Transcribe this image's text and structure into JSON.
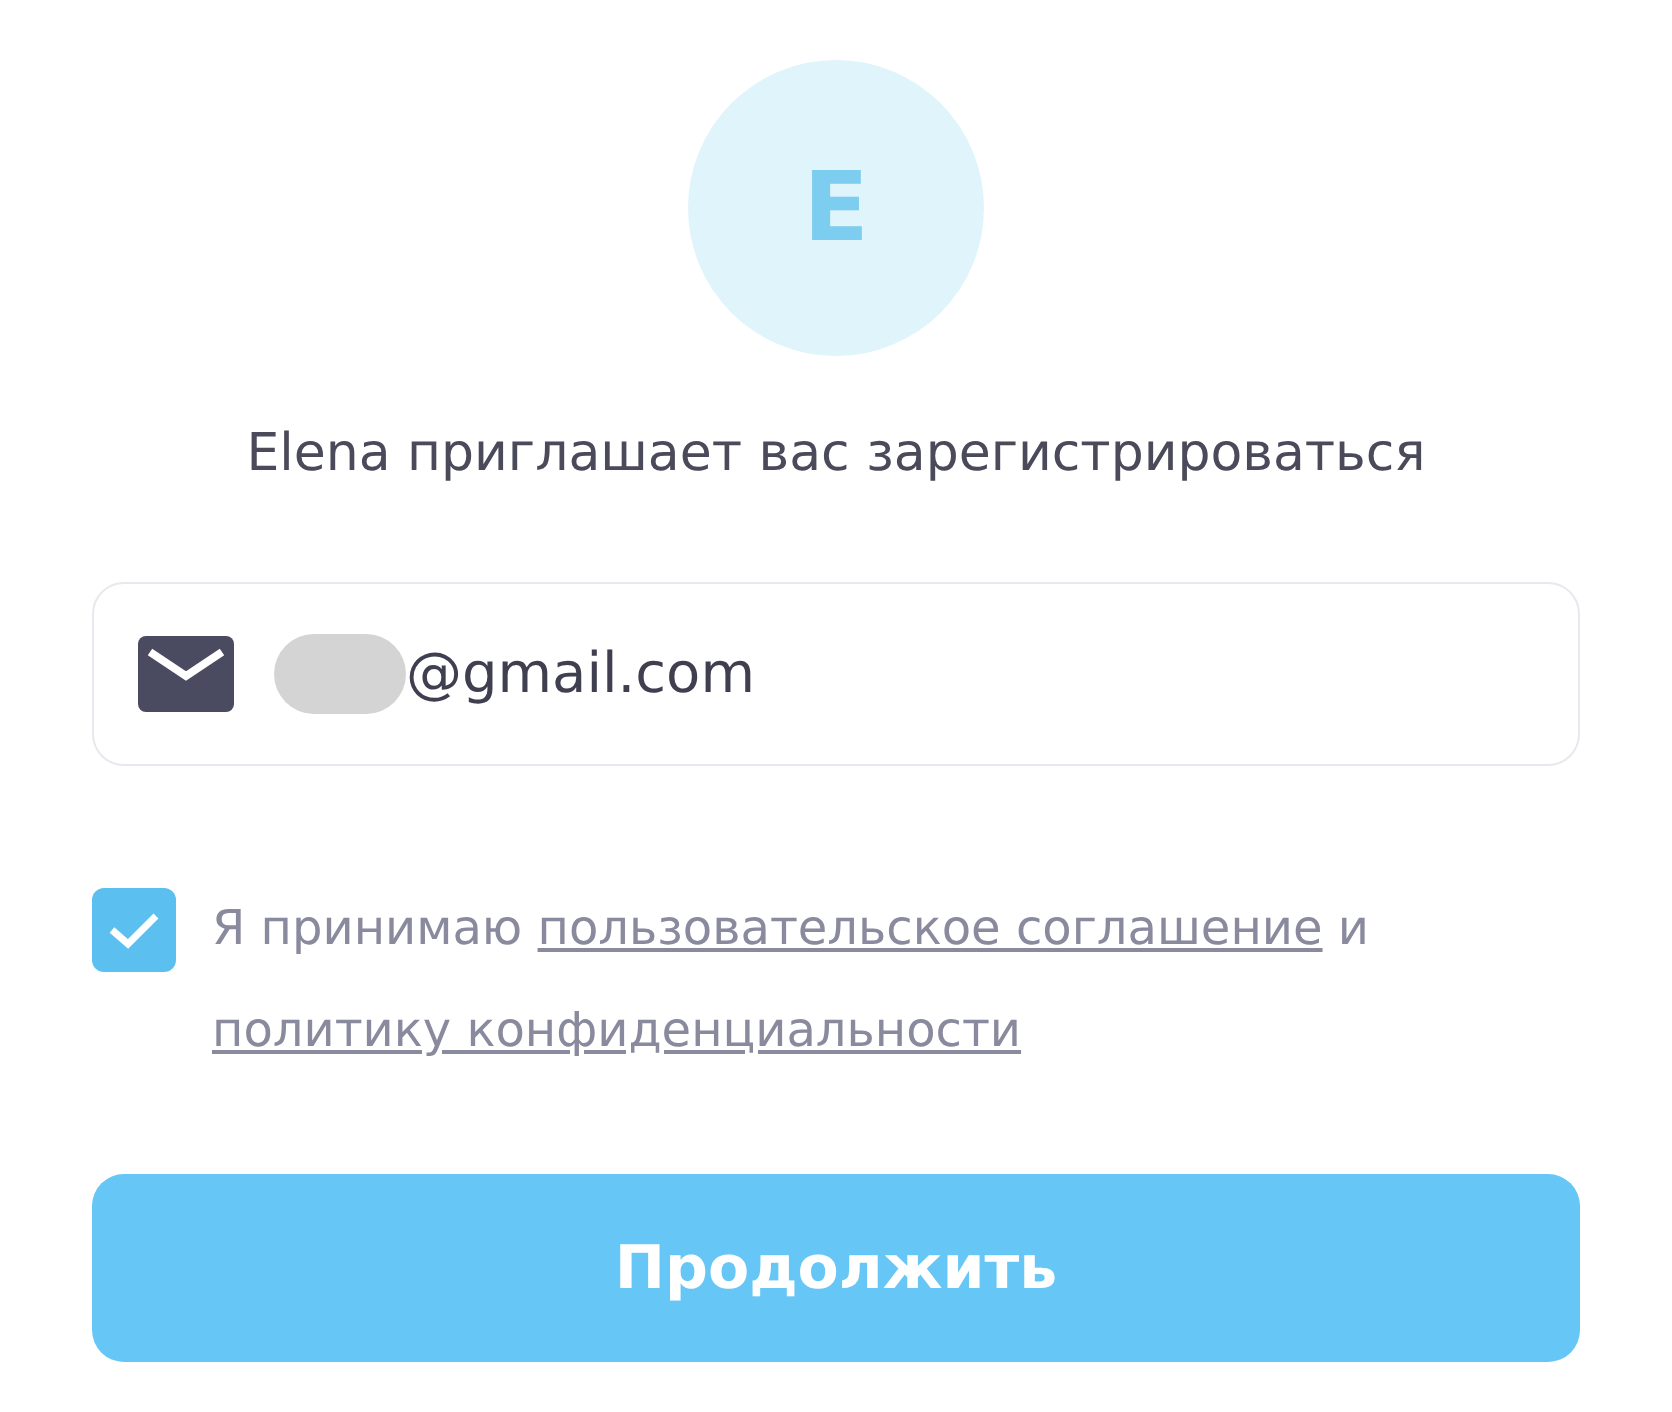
{
  "avatar": {
    "initial": "E"
  },
  "title": "Elena приглашает вас зарегистрироваться",
  "email_field": {
    "value": "@gmail.com",
    "redacted": true
  },
  "consent": {
    "checked": true,
    "parts": [
      {
        "kind": "text",
        "text": "Я принимаю"
      },
      {
        "kind": "link",
        "text": "пользовательское соглашение"
      },
      {
        "kind": "text",
        "text": "и"
      },
      {
        "kind": "link",
        "text": "политику конфиденциальности"
      }
    ]
  },
  "continue_button": {
    "label": "Продолжить"
  }
}
